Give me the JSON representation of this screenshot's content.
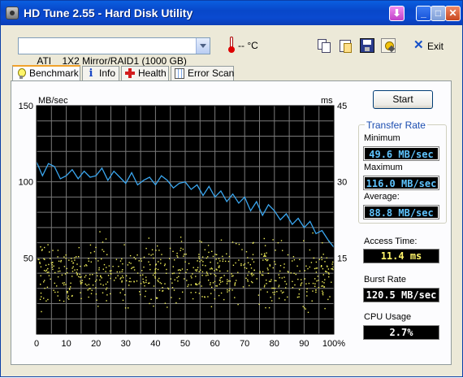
{
  "window": {
    "title": "HD Tune 2.55 - Hard Disk Utility",
    "buttons": {
      "download": "⬇",
      "minimize": "_",
      "maximize": "□",
      "close": "✕"
    }
  },
  "toolbar": {
    "drive": "ATI    1X2 Mirror/RAID1 (1000 GB)",
    "temperature": "-- °C",
    "exit_label": "Exit",
    "icons": [
      "copy-text-icon",
      "copy-screenshot-icon",
      "save-icon",
      "options-icon",
      "exit-icon"
    ]
  },
  "tabs": [
    {
      "label": "Benchmark",
      "icon": "benchmark-bulb-icon",
      "active": true
    },
    {
      "label": "Info",
      "icon": "info-icon",
      "active": false
    },
    {
      "label": "Health",
      "icon": "health-cross-icon",
      "active": false
    },
    {
      "label": "Error Scan",
      "icon": "error-scan-icon",
      "active": false
    }
  ],
  "controls": {
    "start_label": "Start"
  },
  "stats": {
    "group_title": "Transfer Rate",
    "minimum_label": "Minimum",
    "minimum_value": "49.6 MB/sec",
    "maximum_label": "Maximum",
    "maximum_value": "116.0 MB/sec",
    "average_label": "Average:",
    "average_value": "88.8 MB/sec",
    "access_label": "Access Time:",
    "access_value": "11.4 ms",
    "burst_label": "Burst Rate",
    "burst_value": "120.5 MB/sec",
    "cpu_label": "CPU Usage",
    "cpu_value": "2.7%"
  },
  "colors": {
    "plot_background": "#000000",
    "grid": "#7a7a7a",
    "transfer_line": "#3aa6ef",
    "access_dots": "#f2f05a",
    "tab_accent": "#f1a22a"
  },
  "chart_data": {
    "type": "line",
    "title": "",
    "ylabel": "MB/sec",
    "y2label": "ms",
    "xlabel": "",
    "xlim": [
      0,
      100
    ],
    "ylim": [
      0,
      150
    ],
    "y2lim": [
      0,
      45
    ],
    "xticks": [
      "0",
      "10",
      "20",
      "30",
      "40",
      "50",
      "60",
      "70",
      "80",
      "90",
      "100%"
    ],
    "yticks": [
      "150",
      "100",
      "50"
    ],
    "y2ticks": [
      "45",
      "30",
      "15"
    ],
    "grid": true,
    "series": [
      {
        "name": "Transfer Rate",
        "axis": "left",
        "x": [
          0,
          2,
          4,
          6,
          8,
          10,
          12,
          14,
          16,
          18,
          20,
          22,
          24,
          26,
          28,
          30,
          32,
          34,
          36,
          38,
          40,
          42,
          44,
          46,
          48,
          50,
          52,
          54,
          56,
          58,
          60,
          62,
          64,
          66,
          68,
          70,
          72,
          74,
          76,
          78,
          80,
          82,
          84,
          86,
          88,
          90,
          92,
          94,
          96,
          98,
          100
        ],
        "y": [
          113,
          104,
          112,
          110,
          102,
          104,
          108,
          102,
          107,
          103,
          104,
          109,
          101,
          107,
          103,
          99,
          106,
          98,
          101,
          103,
          98,
          104,
          101,
          96,
          99,
          100,
          95,
          98,
          91,
          97,
          90,
          94,
          87,
          92,
          86,
          90,
          81,
          87,
          78,
          85,
          81,
          75,
          79,
          72,
          76,
          70,
          74,
          66,
          68,
          62,
          57
        ]
      },
      {
        "name": "Access Time",
        "axis": "right",
        "type": "scatter",
        "x_range": [
          0,
          100
        ],
        "y_range_ms": [
          3,
          21
        ],
        "mean_ms": 11.4
      }
    ]
  }
}
